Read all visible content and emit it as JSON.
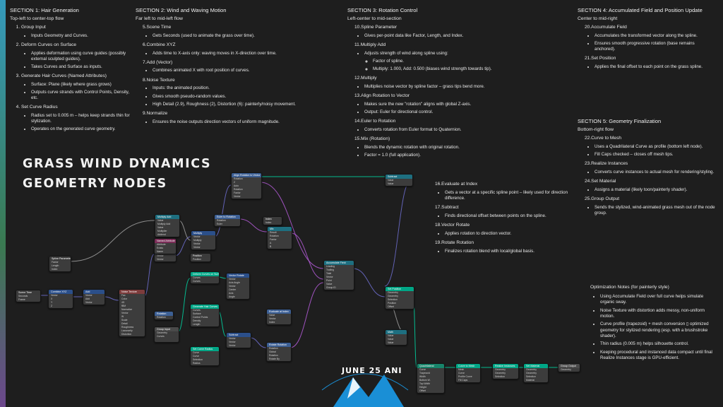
{
  "title_lines": [
    "GRASS WIND DYNAMICS",
    "GEOMETRY NODES"
  ],
  "section1": {
    "heading": "SECTION 1: Hair Generation",
    "sub": "Top-left to center-top flow",
    "items": [
      {
        "label": "Group Input",
        "bullets": [
          "Inputs Geometry and Curves."
        ]
      },
      {
        "label": "Deform Curves on Surface",
        "bullets": [
          "Applies deformation using curve guides (possibly external sculpted guides).",
          "Takes Curves and Surface as inputs."
        ]
      },
      {
        "label": "Generate Hair Curves (Named Attributes)",
        "bullets": [
          "Surface: Plane (likely where grass grows)",
          "Outputs curve strands with Control Points, Density, etc."
        ]
      },
      {
        "label": "Set Curve Radius",
        "bullets": [
          "Radius set to 0.005 m – helps keep strands thin for stylization.",
          "Operates on the generated curve geometry."
        ]
      }
    ]
  },
  "section2": {
    "heading": "SECTION 2: Wind and Waving Motion",
    "sub": "Far left to mid-left flow",
    "items": [
      {
        "num": "5.",
        "label": "Scene Time",
        "bullets": [
          "Gets Seconds (used to animate the grass over time)."
        ]
      },
      {
        "num": "6.",
        "label": "Combine XYZ",
        "bullets": [
          "Adds time to X-axis only: waving moves in X-direction over time."
        ]
      },
      {
        "num": "7.",
        "label": "Add (Vector)",
        "bullets": [
          "Combines animated X with root position of curves."
        ]
      },
      {
        "num": "8.",
        "label": "Noise Texture",
        "bullets": [
          "Inputs: the animated position.",
          "Gives smooth pseudo-random values.",
          "High Detail (2.9), Roughness (2), Distortion (6): painterly/noisy movement."
        ]
      },
      {
        "num": "9.",
        "label": "Normalize",
        "bullets": [
          "Ensures the noise outputs direction vectors of uniform magnitude."
        ]
      }
    ]
  },
  "section3": {
    "heading": "SECTION 3: Rotation Control",
    "sub": "Left-center to mid-section",
    "items": [
      {
        "num": "10.",
        "label": "Spline Parameter",
        "bullets": [
          "Gives per-point data like Factor, Length, and Index."
        ]
      },
      {
        "num": "11.",
        "label": "Multiply Add",
        "bullets": [
          "Adjusts strength of wind along spline using:"
        ],
        "subbullets": [
          "Factor of spline.",
          "Multiply: 1.000, Add: 0.500 (biases wind strength towards tip)."
        ]
      },
      {
        "num": "12.",
        "label": "Multiply",
        "bullets": [
          "Multiplies noise vector by spline factor – grass tips bend more."
        ]
      },
      {
        "num": "13.",
        "label": "Align Rotation to Vector",
        "bullets": [
          "Makes sure the new \"rotation\" aligns with global Z-axis.",
          "Output: Euler for directional control."
        ]
      },
      {
        "num": "14.",
        "label": "Euler to Rotation",
        "bullets": [
          "Converts rotation from Euler format to Quaternion."
        ]
      },
      {
        "num": "15.",
        "label": "Mix (Rotation)",
        "bullets": [
          "Blends the dynamic rotation with original rotation.",
          "Factor = 1.0 (full application)."
        ]
      }
    ]
  },
  "section3b": {
    "items": [
      {
        "num": "16.",
        "label": "Evaluate at Index",
        "bullets": [
          "Gets a vector at a specific spline point – likely used for direction difference."
        ]
      },
      {
        "num": "17.",
        "label": "Subtract",
        "bullets": [
          "Finds directional offset between points on the spline."
        ]
      },
      {
        "num": "18.",
        "label": "Vector Rotate",
        "bullets": [
          "Applies rotation to direction vector."
        ]
      },
      {
        "num": "19.",
        "label": "Rotate Rotation",
        "bullets": [
          "Finalizes rotation blend with local/global basis."
        ]
      }
    ]
  },
  "section4": {
    "heading": "SECTION 4: Accumulated Field and Position Update",
    "sub": "Center to mid-right",
    "items": [
      {
        "num": "20.",
        "label": "Accumulate Field",
        "bullets": [
          "Accumulates the transformed vector along the spline.",
          "Ensures smooth progressive rotation (base remains anchored)."
        ]
      },
      {
        "num": "21.",
        "label": "Set Position",
        "bullets": [
          "Applies the final offset to each point on the grass spline."
        ]
      }
    ]
  },
  "section5": {
    "heading": "SECTION 5: Geometry Finalization",
    "sub": "Bottom-right flow",
    "items": [
      {
        "num": "22.",
        "label": "Curve to Mesh",
        "bullets": [
          "Uses a Quadrilateral Curve as profile (bottom left node).",
          "Fill Caps checked – closes off mesh tips."
        ]
      },
      {
        "num": "23.",
        "label": "Realize Instances",
        "bullets": [
          "Converts curve instances to actual mesh for rendering/styling."
        ]
      },
      {
        "num": "24.",
        "label": "Set Material",
        "bullets": [
          "Assigns a material (likely toon/painterly shader)."
        ]
      },
      {
        "num": "25.",
        "label": "Group Output",
        "bullets": [
          "Sends the stylized, wind-animated grass mesh out of the node group."
        ]
      }
    ]
  },
  "optimization": {
    "heading": "Optimization Notes (for painterly style)",
    "bullets": [
      "Using Accumulate Field over full curve helps simulate organic sway.",
      "Noise Texture with distortion adds messy, non-uniform motion.",
      "Curve profile (trapezoid) + mesh conversion ▯ optimized geometry for stylized rendering (esp. with a brushstroke shader).",
      "Thin radius (0.005 m) helps silhouette control.",
      "Keeping procedural and instanced data compact until final Realize Instances stage is GPU-efficient."
    ]
  },
  "logo": {
    "text": "JUNE 25 ANI",
    "colors": {
      "blue": "#1a8fd6",
      "white": "#ffffff"
    }
  },
  "nodes": [
    {
      "id": "scene-time",
      "title": "Scene Time",
      "hclass": "h-input",
      "rows": [
        "Seconds",
        "Frame"
      ]
    },
    {
      "id": "combine-xyz",
      "title": "Combine XYZ",
      "hclass": "h-vec",
      "rows": [
        "Vector",
        "X",
        "Y",
        "Z"
      ]
    },
    {
      "id": "add-vec",
      "title": "Add",
      "hclass": "h-vec",
      "rows": [
        "Vector",
        "Add",
        "Vector"
      ]
    },
    {
      "id": "spline-param",
      "title": "Spline Parameter",
      "hclass": "h-input",
      "rows": [
        "Factor",
        "Length",
        "Index"
      ]
    },
    {
      "id": "noise-tex",
      "title": "Noise Texture",
      "hclass": "h-tex",
      "rows": [
        "Fac",
        "Color",
        "4D",
        "fBM",
        "Normalize",
        "Vector",
        "W",
        "Scale",
        "Detail",
        "Roughness",
        "Lacunarity",
        "Distortion"
      ]
    },
    {
      "id": "normalize",
      "title": "Normalize",
      "hclass": "h-vec",
      "rows": [
        "Vector",
        "Vector"
      ]
    },
    {
      "id": "multiply-add",
      "title": "Multiply Add",
      "hclass": "h-conv",
      "rows": [
        "Value",
        "Multiply Add",
        "Value",
        "Multiplier",
        "Addend"
      ]
    },
    {
      "id": "multiply",
      "title": "Multiply",
      "hclass": "h-vec",
      "rows": [
        "Vector",
        "Multiply",
        "Vector",
        "Vector"
      ]
    },
    {
      "id": "align-rot",
      "title": "Align Rotation to Vector",
      "hclass": "h-util",
      "rows": [
        "Rotation",
        "Z",
        "Auto",
        "Rotation",
        "Factor",
        "Vector"
      ]
    },
    {
      "id": "euler-rot",
      "title": "Euler to Rotation",
      "hclass": "h-util",
      "rows": [
        "Rotation",
        "Euler"
      ]
    },
    {
      "id": "mix-rot",
      "title": "Mix",
      "hclass": "h-conv",
      "rows": [
        "Result",
        "Rotation",
        "Factor",
        "A",
        "B"
      ]
    },
    {
      "id": "group-input",
      "title": "Group Input",
      "hclass": "h-out",
      "rows": [
        "Geometry",
        "Curves",
        ""
      ]
    },
    {
      "id": "deform-curves",
      "title": "Deform Curves on Surface",
      "hclass": "h-geo",
      "rows": [
        "Curves",
        "Curves"
      ]
    },
    {
      "id": "gen-hair",
      "title": "Generate Hair Curves",
      "hclass": "h-geo",
      "rows": [
        "Curves",
        "Surface",
        "Control Points",
        "Density",
        "Length"
      ]
    },
    {
      "id": "set-radius",
      "title": "Set Curve Radius",
      "hclass": "h-geo",
      "rows": [
        "Curve",
        "Curve",
        "Selection",
        "Radius"
      ]
    },
    {
      "id": "vector-rotate",
      "title": "Vector Rotate",
      "hclass": "h-vec",
      "rows": [
        "Vector",
        "Axis Angle",
        "Vector",
        "Center",
        "Axis",
        "Angle"
      ]
    },
    {
      "id": "eval-index",
      "title": "Evaluate at Index",
      "hclass": "h-util",
      "rows": [
        "Value",
        "Vector",
        "Index"
      ]
    },
    {
      "id": "subtract",
      "title": "Subtract",
      "hclass": "h-vec",
      "rows": [
        "Vector",
        "Vector",
        "Vector"
      ]
    },
    {
      "id": "rotate-rot",
      "title": "Rotate Rotation",
      "hclass": "h-util",
      "rows": [
        "Rotation",
        "Global",
        "Rotation",
        "Rotate By"
      ]
    },
    {
      "id": "accumulate",
      "title": "Accumulate Field",
      "hclass": "h-conv",
      "rows": [
        "Leading",
        "Trailing",
        "Total",
        "Vector",
        "Point",
        "Value",
        "Group ID"
      ]
    },
    {
      "id": "set-position",
      "title": "Set Position",
      "hclass": "h-geo",
      "rows": [
        "Geometry",
        "Geometry",
        "Selection",
        "Position",
        "Offset"
      ]
    },
    {
      "id": "quadrilateral",
      "title": "Quadrilateral",
      "hclass": "h-curve",
      "rows": [
        "Curve",
        "Trapezoid",
        "Width",
        "Bottom W.",
        "Top Width",
        "Height",
        "Offset"
      ]
    },
    {
      "id": "curve-to-mesh",
      "title": "Curve to Mesh",
      "hclass": "h-geo",
      "rows": [
        "Mesh",
        "Curve",
        "Profile Curve",
        "Fill Caps"
      ]
    },
    {
      "id": "realize",
      "title": "Realize Instances",
      "hclass": "h-geo",
      "rows": [
        "Geometry",
        "Geometry",
        "Selection"
      ]
    },
    {
      "id": "set-material",
      "title": "Set Material",
      "hclass": "h-geo",
      "rows": [
        "Geometry",
        "Geometry",
        "Selection",
        "Material"
      ]
    },
    {
      "id": "group-output",
      "title": "Group Output",
      "hclass": "h-out",
      "rows": [
        "Geometry"
      ]
    },
    {
      "id": "small-a",
      "title": "Position",
      "hclass": "h-input",
      "rows": [
        "Position"
      ]
    },
    {
      "id": "small-b",
      "title": "Index",
      "hclass": "h-input",
      "rows": [
        "Index"
      ]
    },
    {
      "id": "small-c",
      "title": "Subtract",
      "hclass": "h-conv",
      "rows": [
        "Value",
        "Value"
      ]
    },
    {
      "id": "small-d",
      "title": "Math",
      "hclass": "h-conv",
      "rows": [
        "Value",
        "Value",
        "Value"
      ]
    },
    {
      "id": "small-e",
      "title": "Rotation",
      "hclass": "h-util",
      "rows": [
        "Rotation"
      ]
    },
    {
      "id": "small-f",
      "title": "Named Attribute",
      "hclass": "h-attr",
      "rows": [
        "Attribute",
        "Exists",
        "Name"
      ]
    }
  ]
}
